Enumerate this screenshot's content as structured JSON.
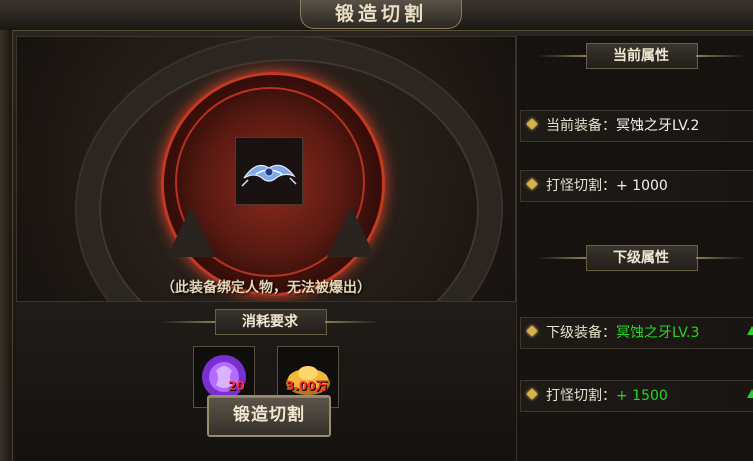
{
  "window": {
    "title": "锻造切割"
  },
  "stage": {
    "bind_note": "（此装备绑定人物，无法被爆出）"
  },
  "consume": {
    "title": "消耗要求",
    "items": [
      {
        "icon": "purple-gem-icon",
        "count": "20"
      },
      {
        "icon": "gold-ingot-icon",
        "count": "3.00万"
      }
    ]
  },
  "forge_button": {
    "label": "锻造切割"
  },
  "current": {
    "title": "当前属性",
    "equip_label": "当前装备：",
    "equip_value": "冥蚀之牙LV.2",
    "cut_label": "打怪切割：",
    "cut_value": "+ 1000"
  },
  "next": {
    "title": "下级属性",
    "equip_label": "下级装备：",
    "equip_value": "冥蚀之牙LV.3",
    "cut_label": "打怪切割：",
    "cut_value": "+ 1500"
  },
  "colors": {
    "accent_red": "#c23a22",
    "upgrade_green": "#23d823",
    "gold": "#d7b24a"
  }
}
